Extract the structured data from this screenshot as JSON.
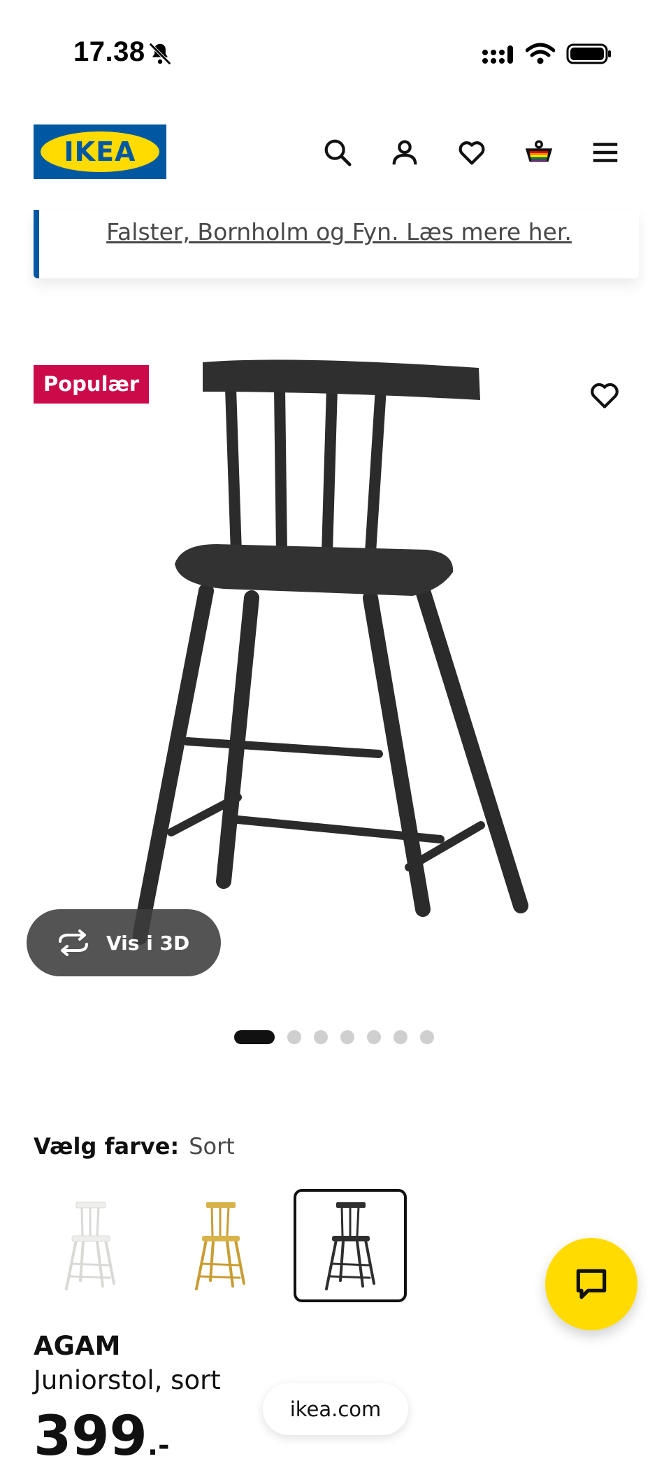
{
  "status_bar": {
    "time": "17.38"
  },
  "header": {
    "logo_text": "IKEA",
    "icons": [
      "search-icon",
      "account-icon",
      "heart-icon",
      "basket-icon",
      "menu-icon"
    ]
  },
  "notice": {
    "link_text": "Falster, Bornholm og Fyn. Læs mere her."
  },
  "product_media": {
    "badge": "Populær",
    "view_3d_label": "Vis i 3D",
    "carousel": {
      "total": 7,
      "active_index": 0
    }
  },
  "color_selection": {
    "label": "Vælg farve:",
    "selected_value": "Sort",
    "options": [
      {
        "color": "#eeeeec",
        "stroke": "#d8d8d6"
      },
      {
        "color": "#d9b24a",
        "stroke": "#c79c32"
      },
      {
        "color": "#2e2e2e",
        "stroke": "#222222",
        "selected": true
      }
    ]
  },
  "product": {
    "name": "AGAM",
    "description": "Juniorstol, sort",
    "price": "399",
    "price_suffix": ".-"
  },
  "browser": {
    "url": "ikea.com"
  },
  "colors": {
    "ikea_blue": "#0058a3",
    "ikea_yellow": "#ffdb00",
    "badge_red": "#cc0a4a"
  }
}
